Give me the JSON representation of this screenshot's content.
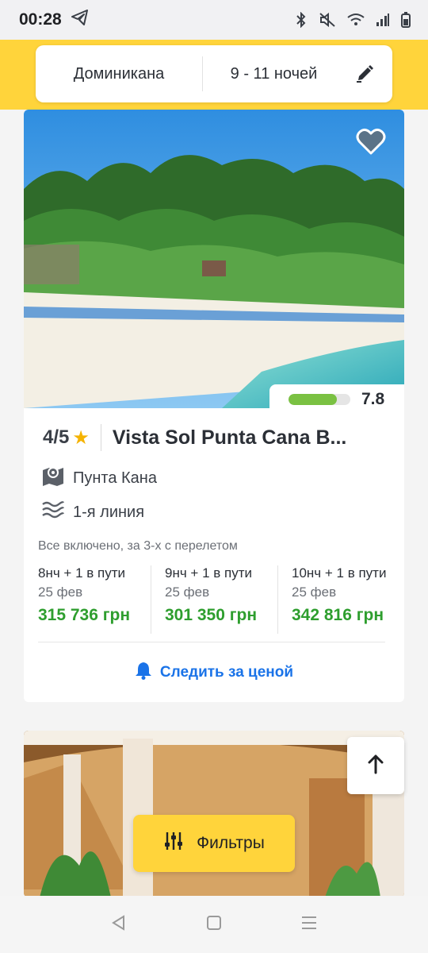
{
  "status": {
    "time": "00:28",
    "icons": [
      "telegram-icon",
      "bluetooth-icon",
      "mute-icon",
      "wifi-icon",
      "signal-icon",
      "battery-icon"
    ]
  },
  "search": {
    "destination": "Доминикана",
    "nights": "9 - 11 ночей",
    "edit_icon": "pencil-icon"
  },
  "hotel": {
    "rating_score": "7.8",
    "rating_fraction": 0.78,
    "stars": "4/5",
    "name": "Vista Sol Punta Cana B...",
    "city": "Пунта Кана",
    "beach_line": "1-я линия",
    "board": "Все включено, за 3-х с перелетом",
    "offers": [
      {
        "nights": "8нч + 1 в пути",
        "date": "25 фев",
        "price": "315 736 грн"
      },
      {
        "nights": "9нч + 1 в пути",
        "date": "25 фев",
        "price": "301 350 грн"
      },
      {
        "nights": "10нч + 1 в пути",
        "date": "25 фев",
        "price": "342 816 грн"
      }
    ],
    "watch_label": "Следить за ценой"
  },
  "filters_label": "Фильтры",
  "colors": {
    "accent_yellow": "#ffd43b",
    "price_green": "#2e9e2e",
    "link_blue": "#1a73e8",
    "rating_green": "#7ac142"
  }
}
